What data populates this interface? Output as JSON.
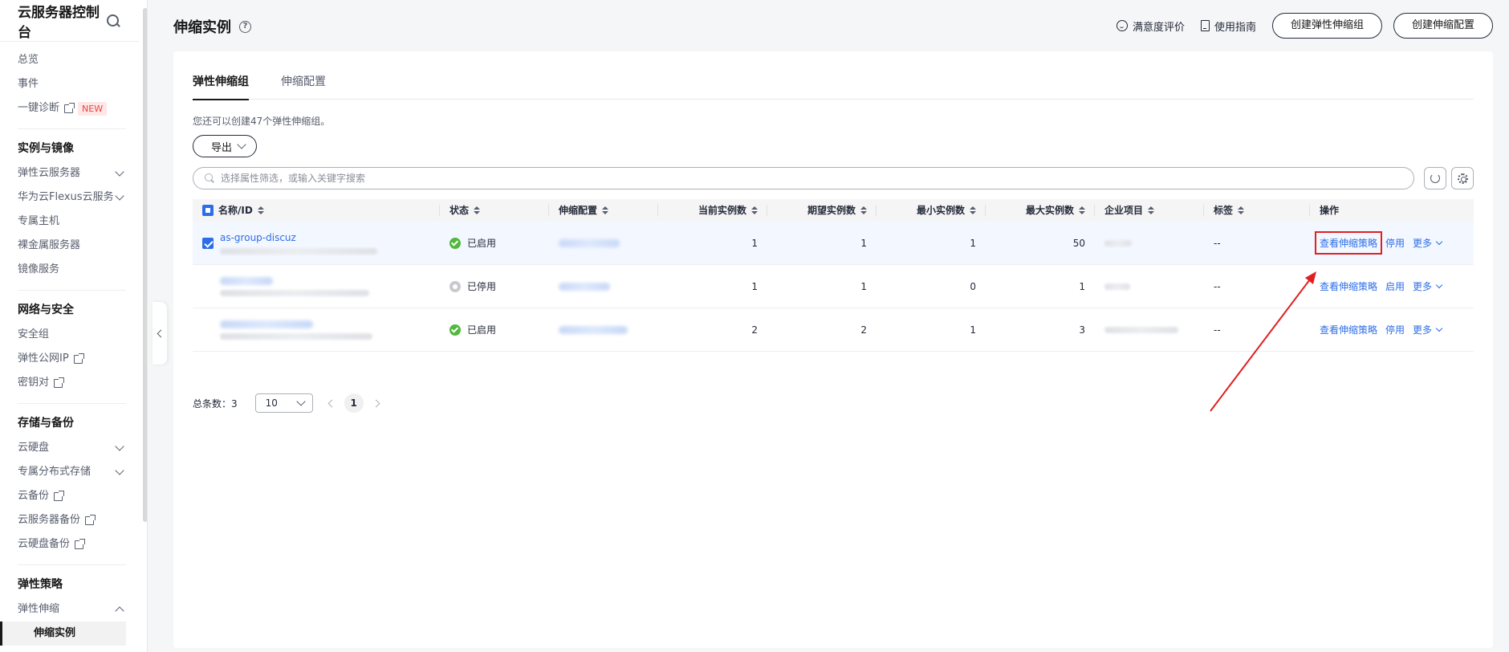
{
  "sidebar": {
    "title": "云服务器控制台",
    "top_items": [
      {
        "label": "总览"
      },
      {
        "label": "事件"
      },
      {
        "label": "一键诊断",
        "badge": "NEW"
      }
    ],
    "groups": [
      {
        "title": "实例与镜像",
        "items": [
          "弹性云服务器",
          "华为云Flexus云服务",
          "专属主机",
          "裸金属服务器",
          "镜像服务"
        ]
      },
      {
        "title": "网络与安全",
        "items": [
          "安全组",
          "弹性公网IP",
          "密钥对"
        ]
      },
      {
        "title": "存储与备份",
        "items": [
          "云硬盘",
          "专属分布式存储",
          "云备份",
          "云服务器备份",
          "云硬盘备份"
        ]
      },
      {
        "title": "弹性策略",
        "items": [
          "弹性伸缩"
        ],
        "sub_active": "伸缩实例"
      }
    ]
  },
  "header": {
    "title": "伸缩实例",
    "help": "?",
    "satisfaction": "满意度评价",
    "guide": "使用指南",
    "btn_create_group": "创建弹性伸缩组",
    "btn_create_config": "创建伸缩配置"
  },
  "tabs": [
    "弹性伸缩组",
    "伸缩配置"
  ],
  "hint": "您还可以创建47个弹性伸缩组。",
  "export_label": "导出",
  "search_placeholder": "选择属性筛选，或输入关键字搜索",
  "table": {
    "columns": [
      "名称/ID",
      "状态",
      "伸缩配置",
      "当前实例数",
      "期望实例数",
      "最小实例数",
      "最大实例数",
      "企业项目",
      "标签",
      "操作"
    ],
    "rows": [
      {
        "name": "as-group-discuz",
        "status": "已启用",
        "status_type": "on",
        "current": "1",
        "desired": "1",
        "min": "1",
        "max": "50",
        "tag": "--",
        "op_view": "查看伸缩策略",
        "op_toggle": "停用",
        "op_more": "更多",
        "checked": true
      },
      {
        "name": "",
        "status": "已停用",
        "status_type": "off",
        "current": "1",
        "desired": "1",
        "min": "0",
        "max": "1",
        "tag": "--",
        "op_view": "查看伸缩策略",
        "op_toggle": "启用",
        "op_more": "更多",
        "checked": false
      },
      {
        "name": "",
        "status": "已启用",
        "status_type": "on",
        "current": "2",
        "desired": "2",
        "min": "1",
        "max": "3",
        "tag": "--",
        "op_view": "查看伸缩策略",
        "op_toggle": "停用",
        "op_more": "更多",
        "checked": false
      }
    ]
  },
  "pager": {
    "total_label": "总条数：",
    "total": "3",
    "page_size": "10",
    "current_page": "1"
  },
  "colors": {
    "link": "#2c6ee8",
    "enabled": "#50b83c",
    "annotation": "#e02020"
  }
}
